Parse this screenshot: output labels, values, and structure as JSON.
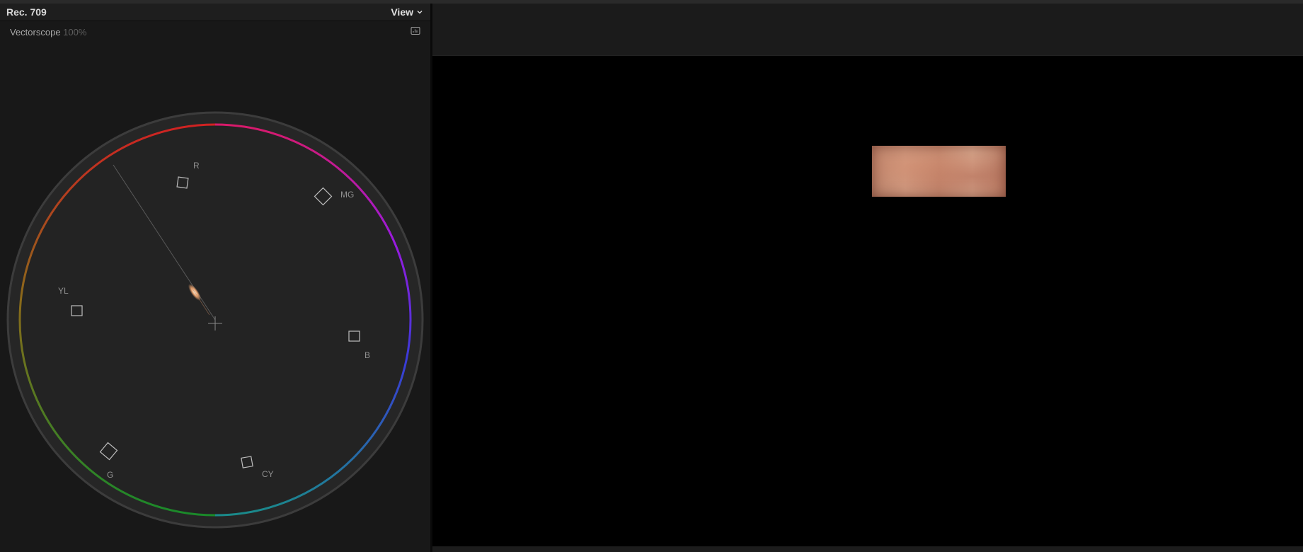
{
  "scope": {
    "standard": "Rec. 709",
    "view_label": "View",
    "title": "Vectorscope",
    "zoom": "100%",
    "targets": [
      {
        "id": "R",
        "label": "R"
      },
      {
        "id": "MG",
        "label": "MG"
      },
      {
        "id": "B",
        "label": "B"
      },
      {
        "id": "CY",
        "label": "CY"
      },
      {
        "id": "G",
        "label": "G"
      },
      {
        "id": "YL",
        "label": "YL"
      }
    ]
  },
  "icons": {
    "view_chevron": "chevron-down-icon",
    "scope_settings": "scope-settings-icon",
    "center": "crosshair-icon"
  },
  "colors": {
    "panel_bg": "#181818",
    "graticule_ring": "#3a3a3a",
    "target_box": "#bdbdbd",
    "skin_trace": "#e8b088"
  }
}
